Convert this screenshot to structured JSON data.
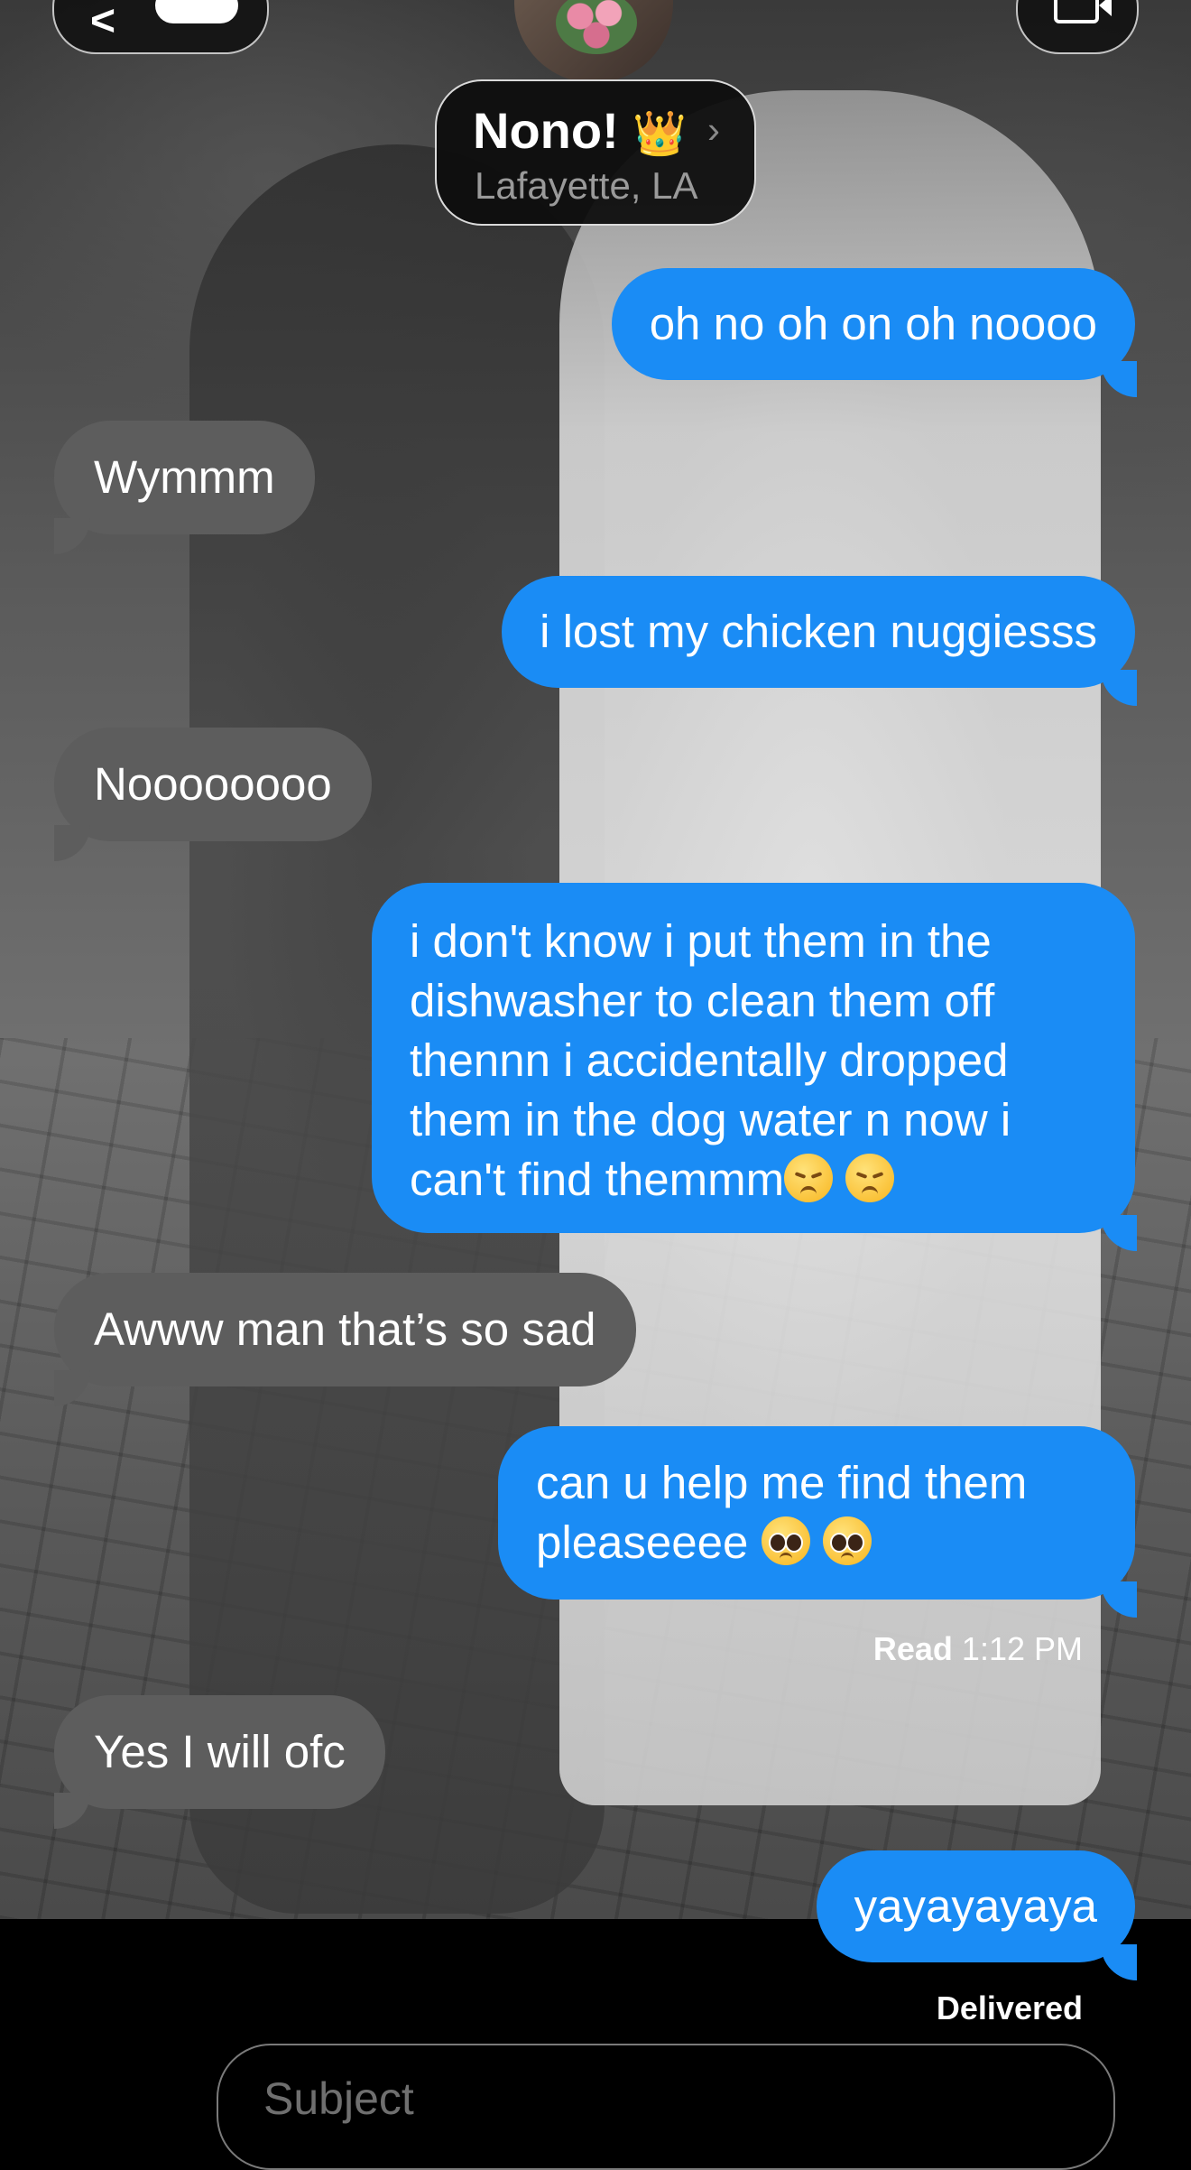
{
  "header": {
    "contact_name": "Nono!",
    "contact_emoji": "👑",
    "contact_location": "Lafayette, LA"
  },
  "messages": [
    {
      "direction": "outgoing",
      "text": "oh no oh on oh noooo"
    },
    {
      "direction": "incoming",
      "text": "Wymmm"
    },
    {
      "direction": "outgoing",
      "text": "i lost my chicken nuggiesss"
    },
    {
      "direction": "incoming",
      "text": "Noooooooo"
    },
    {
      "direction": "outgoing",
      "lines": [
        "i don't know i put them in the",
        "dishwasher to clean them off",
        "thennn i accidentally dropped",
        "them in the dog water n now i",
        "can't find themmm"
      ],
      "emoji": "😞 😞"
    },
    {
      "direction": "incoming",
      "text": "Awww man that’s so sad"
    },
    {
      "direction": "outgoing",
      "lines": [
        "can u help me find them",
        "pleaseeee"
      ],
      "emoji": "🥺 🥺"
    },
    {
      "direction": "incoming",
      "text": "Yes I will ofc"
    },
    {
      "direction": "outgoing",
      "text": "yayayayaya"
    }
  ],
  "read_receipt": {
    "label": "Read",
    "time": "1:12 PM"
  },
  "delivered_label": "Delivered",
  "compose": {
    "subject_placeholder": "Subject"
  },
  "colors": {
    "outgoing_bubble": "#1a8cf5",
    "incoming_bubble": "#5d5d5d",
    "background": "#000000"
  },
  "icons": [
    "back-chevron-icon",
    "video-camera-icon",
    "chevron-right-icon"
  ]
}
